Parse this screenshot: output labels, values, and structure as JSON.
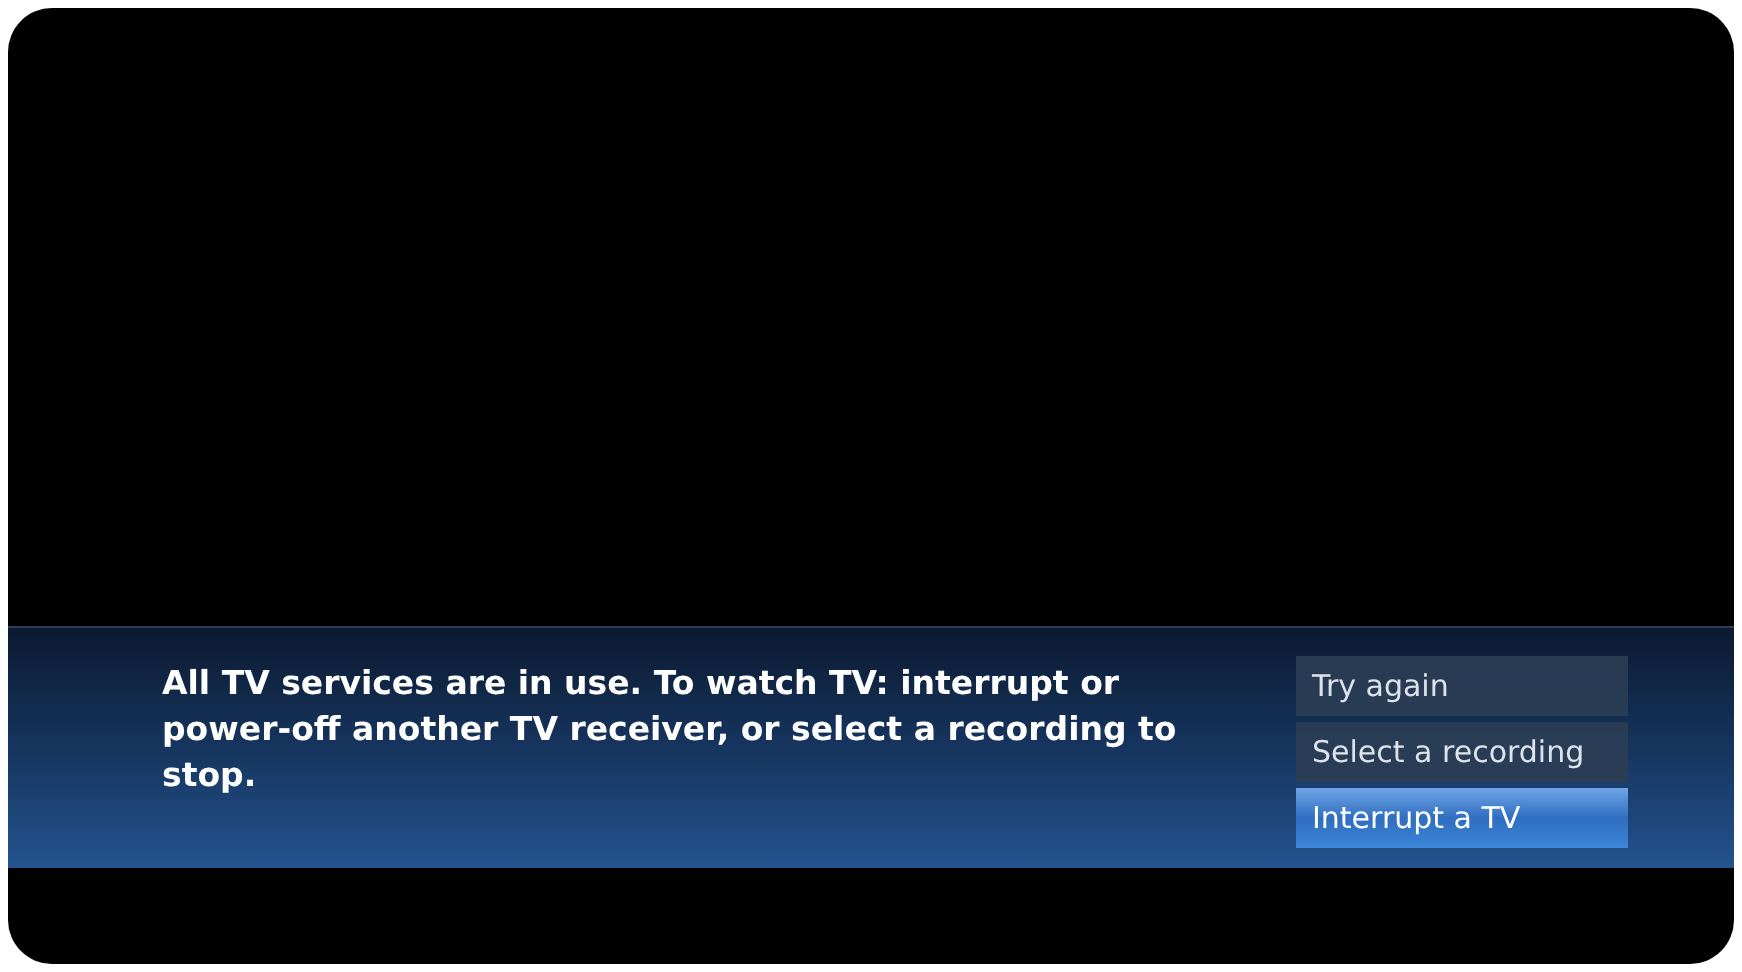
{
  "dialog": {
    "message": "All TV services are in use. To watch TV: interrupt or power-off another TV receiver, or select a recording to stop.",
    "options": [
      {
        "label": "Try again",
        "selected": false
      },
      {
        "label": "Select a recording",
        "selected": false
      },
      {
        "label": "Interrupt a TV",
        "selected": true
      }
    ]
  }
}
